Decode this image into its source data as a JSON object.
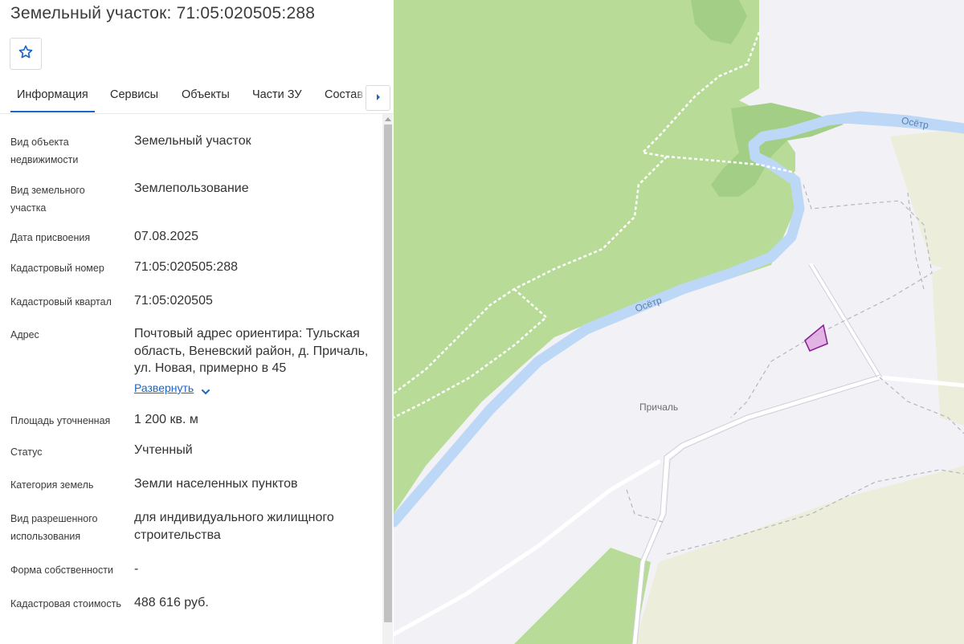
{
  "header": {
    "title": "Земельный участок: 71:05:020505:288",
    "favorite_icon": "star-outline-icon"
  },
  "tabs": [
    {
      "label": "Информация",
      "active": true
    },
    {
      "label": "Сервисы",
      "active": false
    },
    {
      "label": "Объекты",
      "active": false
    },
    {
      "label": "Части ЗУ",
      "active": false
    },
    {
      "label": "Состав",
      "active": false
    }
  ],
  "tabs_next_icon": "caret-right-icon",
  "info": {
    "object_type": {
      "label": "Вид объекта недвижимости",
      "value": "Земельный участок"
    },
    "land_type": {
      "label": "Вид земельного участка",
      "value": "Землепользование"
    },
    "assign_date": {
      "label": "Дата присвоения",
      "value": "07.08.2025"
    },
    "cadastral_number": {
      "label": "Кадастровый номер",
      "value": "71:05:020505:288"
    },
    "cadastral_quarter": {
      "label": "Кадастровый квартал",
      "value": "71:05:020505"
    },
    "address": {
      "label": "Адрес",
      "value": "Почтовый адрес ориентира: Тульская область, Веневский район, д. Причаль, ул. Новая, примерно в 45",
      "expand_label": "Развернуть"
    },
    "area": {
      "label": "Площадь уточненная",
      "value": "1 200 кв. м"
    },
    "status": {
      "label": "Статус",
      "value": "Учтенный"
    },
    "land_category": {
      "label": "Категория земель",
      "value": "Земли населенных пунктов"
    },
    "permitted_use": {
      "label": "Вид разрешенного использования",
      "value": "для индивидуального жилищного строительства"
    },
    "ownership": {
      "label": "Форма собственности",
      "value": "-"
    },
    "cadastral_cost": {
      "label": "Кадастровая стоимость",
      "value": "488 616 руб."
    }
  },
  "map": {
    "river_label_1": "Осётр",
    "river_label_2": "Осётр",
    "village_label": "Причаль",
    "colors": {
      "forest": "#b8dc98",
      "forest_dark": "#a2cf85",
      "river": "#bcd8f6",
      "background": "#f2f2f6",
      "field": "#ededdb",
      "parcel_fill": "#dfa9e0",
      "parcel_stroke": "#8b1a94"
    }
  }
}
